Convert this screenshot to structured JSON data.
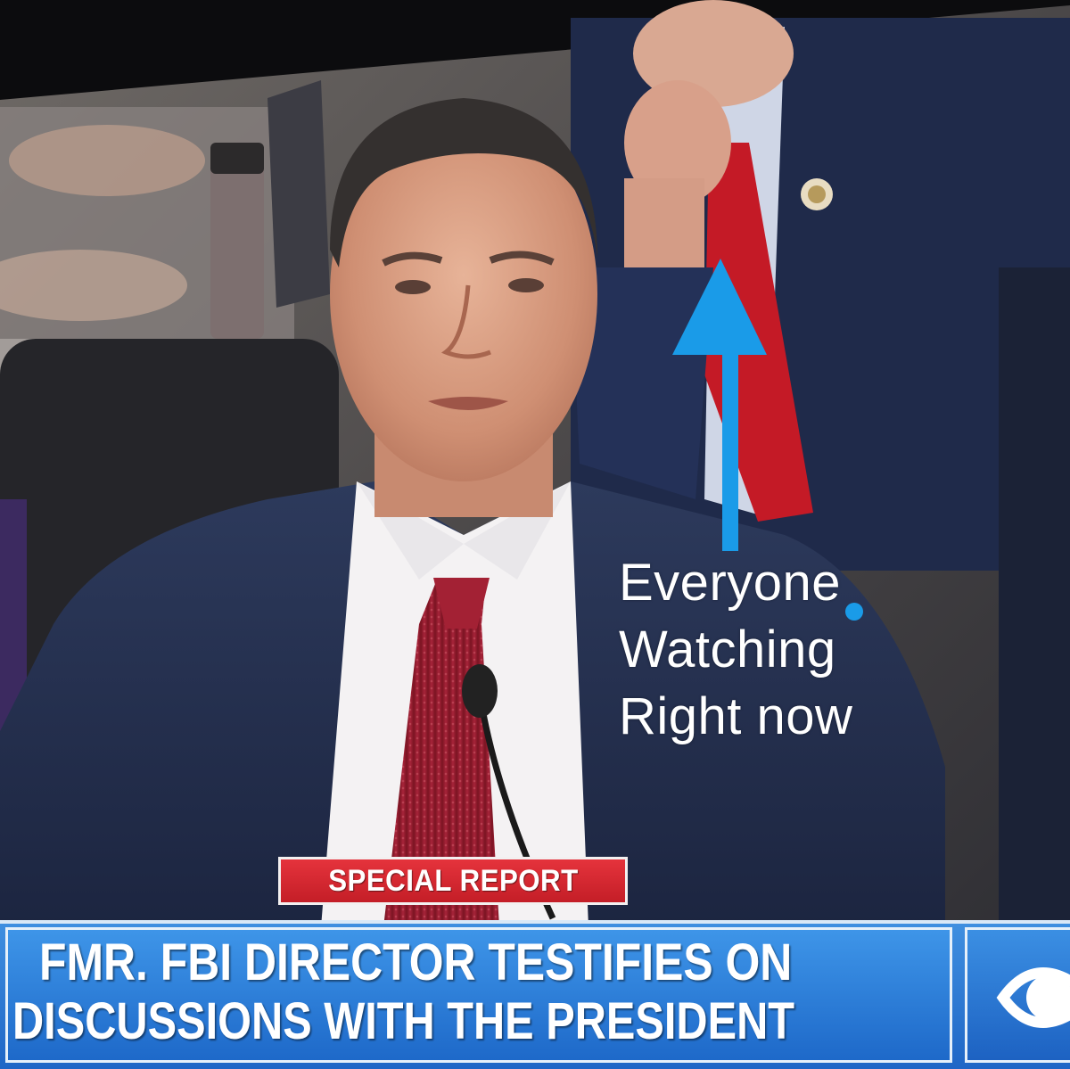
{
  "annotation": {
    "lines": [
      "Everyone",
      "Watching",
      "Right now"
    ],
    "arrow_color": "#1a9be8"
  },
  "broadcast": {
    "badge": "SPECIAL REPORT",
    "headline": {
      "line1": "FMR. FBI DIRECTOR TESTIFIES ON",
      "line2": "DISCUSSIONS WITH THE PRESIDENT"
    },
    "network_logo": "eye-logo-icon",
    "colors": {
      "badge": "#d52a33",
      "ticker": "#2f7fd8"
    }
  }
}
